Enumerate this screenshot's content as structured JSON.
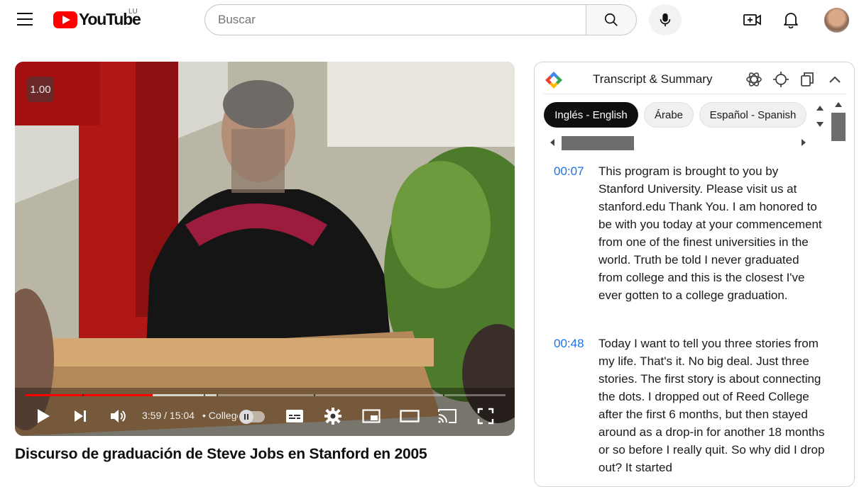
{
  "header": {
    "logo_text": "YouTube",
    "country_code": "LU",
    "search_placeholder": "Buscar",
    "icons": [
      "menu-icon",
      "search-icon",
      "mic-icon",
      "create-icon",
      "notifications-icon",
      "avatar"
    ]
  },
  "video": {
    "speed_badge": "1.00",
    "time": "3:59 / 15:04",
    "chapter_separator": "•",
    "chapter": "College",
    "progress_played_fraction": 0.265,
    "progress_buffered_fraction": 0.4,
    "title": "Discurso de graduación de Steve Jobs en Stanford en 2005"
  },
  "transcript_panel": {
    "title": "Transcript & Summary",
    "languages": [
      {
        "label": "Inglés - English",
        "active": true
      },
      {
        "label": "Árabe",
        "active": false
      },
      {
        "label": "Español - Spanish",
        "active": false
      }
    ],
    "segments": [
      {
        "time": "00:07",
        "text": "This program is brought to you by Stanford University. Please visit us at stanford.edu Thank You. I am honored to be with you today at your commencement from one of the finest universities in the world. Truth be told I never graduated from college and this is the closest I've ever gotten to a college graduation."
      },
      {
        "time": "00:48",
        "text": "Today I want to tell you three stories from my life. That's it. No big deal. Just three stories. The first story is about connecting the dots. I dropped out of Reed College after the first 6 months, but then stayed around as a drop-in for another 18 months or so before I really quit. So why did I drop out? It started"
      }
    ]
  },
  "colors": {
    "brand_red": "#ff0000",
    "timestamp_blue": "#1a73e8",
    "active_chip": "#0f0f0f"
  }
}
